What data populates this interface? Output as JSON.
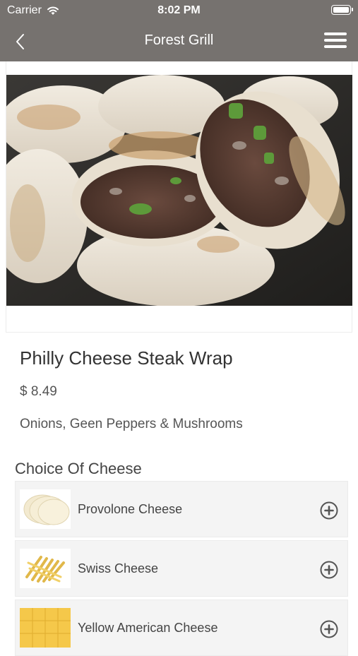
{
  "status_bar": {
    "carrier": "Carrier",
    "time": "8:02 PM"
  },
  "nav": {
    "title": "Forest Grill",
    "back_icon": "chevron-left-icon",
    "menu_icon": "hamburger-menu-icon"
  },
  "item": {
    "name": "Philly Cheese Steak Wrap",
    "price": "$ 8.49",
    "description": "Onions, Geen Peppers & Mushrooms"
  },
  "options_section": {
    "title": "Choice Of Cheese",
    "options": [
      {
        "label": "Provolone Cheese",
        "icon": "add-circle-icon"
      },
      {
        "label": "Swiss Cheese",
        "icon": "add-circle-icon"
      },
      {
        "label": "Yellow American Cheese",
        "icon": "add-circle-icon"
      }
    ]
  },
  "colors": {
    "bar_background": "#76726f",
    "row_background": "#f4f4f4"
  }
}
